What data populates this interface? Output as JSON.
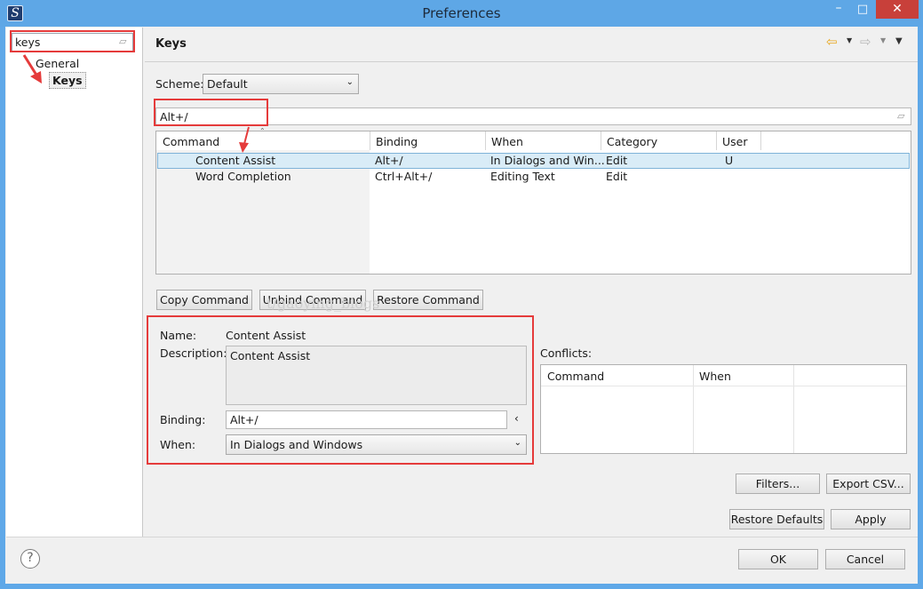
{
  "window": {
    "title": "Preferences",
    "icon": "app-logo-icon",
    "min": "–",
    "max": "□",
    "close": "✕"
  },
  "left": {
    "filter_text": "keys",
    "tree": [
      {
        "label": "General"
      },
      {
        "label": "Keys"
      }
    ]
  },
  "header": {
    "title": "Keys"
  },
  "scheme": {
    "label": "Scheme:",
    "value": "Default"
  },
  "keys_filter": {
    "value": "Alt+/"
  },
  "table": {
    "columns": [
      "Command",
      "Binding",
      "When",
      "Category",
      "User"
    ],
    "rows": [
      {
        "command": "Content Assist",
        "binding": "Alt+/",
        "when": "In Dialogs and Win...",
        "category": "Edit",
        "user": "U",
        "selected": true
      },
      {
        "command": "Word Completion",
        "binding": "Ctrl+Alt+/",
        "when": "Editing Text",
        "category": "Edit",
        "user": "",
        "selected": false
      }
    ]
  },
  "buttons": {
    "copy": "Copy Command",
    "unbind": "Unbind Command",
    "restore": "Restore Command",
    "filters": "Filters...",
    "export": "Export CSV...",
    "restore_defaults": "Restore Defaults",
    "apply": "Apply",
    "ok": "OK",
    "cancel": "Cancel"
  },
  "watermark": "t/gaoying_blogs",
  "details": {
    "name_label": "Name:",
    "name_value": "Content Assist",
    "description_label": "Description:",
    "description_value": "Content Assist",
    "binding_label": "Binding:",
    "binding_value": "Alt+/",
    "binding_menu": "‹",
    "when_label": "When:",
    "when_value": "In Dialogs and Windows"
  },
  "conflicts": {
    "label": "Conflicts:",
    "columns": [
      "Command",
      "When"
    ]
  },
  "help": "?",
  "colors": {
    "annotation": "#e53b3b",
    "selection": "#d9ecf7",
    "titlebar": "#5ea7e6",
    "close": "#c8403a"
  }
}
